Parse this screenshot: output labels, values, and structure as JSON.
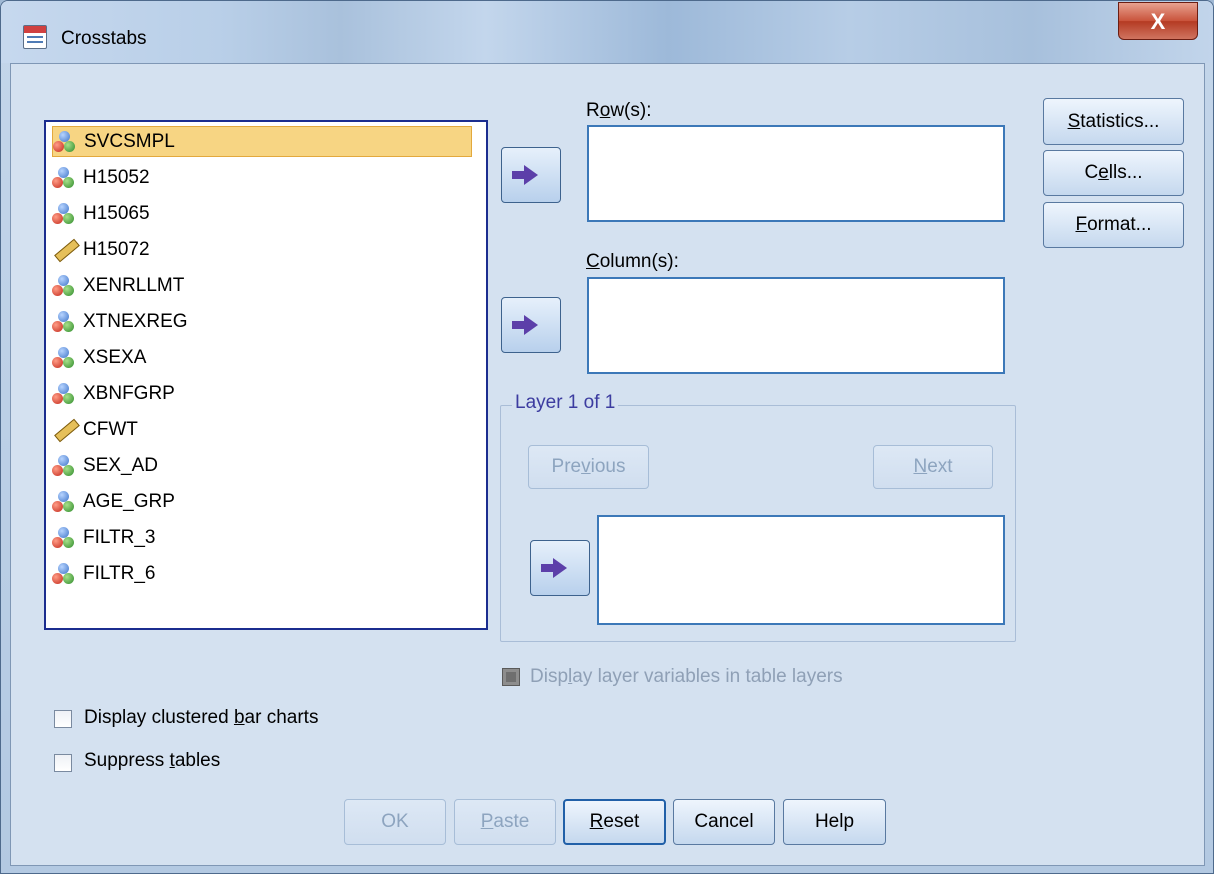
{
  "window": {
    "title": "Crosstabs",
    "close_label": "X"
  },
  "variables": [
    {
      "name": "SVCSMPL",
      "icon": "nominal-icon",
      "selected": true
    },
    {
      "name": "H15052",
      "icon": "nominal-icon"
    },
    {
      "name": "H15065",
      "icon": "nominal-icon"
    },
    {
      "name": "H15072",
      "icon": "scale-icon"
    },
    {
      "name": "XENRLLMT",
      "icon": "nominal-icon"
    },
    {
      "name": "XTNEXREG",
      "icon": "nominal-icon"
    },
    {
      "name": "XSEXA",
      "icon": "nominal-icon"
    },
    {
      "name": "XBNFGRP",
      "icon": "nominal-icon"
    },
    {
      "name": "CFWT",
      "icon": "scale-icon"
    },
    {
      "name": "SEX_AD",
      "icon": "nominal-icon"
    },
    {
      "name": "AGE_GRP",
      "icon": "nominal-icon"
    },
    {
      "name": "FILTR_3",
      "icon": "nominal-icon"
    },
    {
      "name": "FILTR_6",
      "icon": "nominal-icon"
    }
  ],
  "rows": {
    "label_pre": "R",
    "label_u": "o",
    "label_post": "w(s):"
  },
  "columns": {
    "label_pre": "",
    "label_u": "C",
    "label_post": "olumn(s):"
  },
  "layer": {
    "legend": "Layer 1 of 1",
    "previous_pre": "Pre",
    "previous_u": "v",
    "previous_post": "ious",
    "next_pre": "",
    "next_u": "N",
    "next_post": "ext",
    "display_pre": "Disp",
    "display_u": "l",
    "display_post": "ay layer variables in table layers"
  },
  "side_buttons": {
    "statistics_u": "S",
    "statistics_post": "tatistics...",
    "cells_pre": "C",
    "cells_u": "e",
    "cells_post": "lls...",
    "format_u": "F",
    "format_post": "ormat..."
  },
  "options": {
    "clustered_pre": "Display clustered ",
    "clustered_u": "b",
    "clustered_post": "ar charts",
    "suppress_pre": "Suppress ",
    "suppress_u": "t",
    "suppress_post": "ables"
  },
  "buttons": {
    "ok": "OK",
    "paste_u": "P",
    "paste_post": "aste",
    "reset_u": "R",
    "reset_post": "eset",
    "cancel": "Cancel",
    "help": "Help"
  },
  "colors": {
    "selection": "#f7d583",
    "list_border": "#1b2d8f",
    "layer_legend": "#3c3ca0",
    "arrow": "#5c3fa9"
  }
}
